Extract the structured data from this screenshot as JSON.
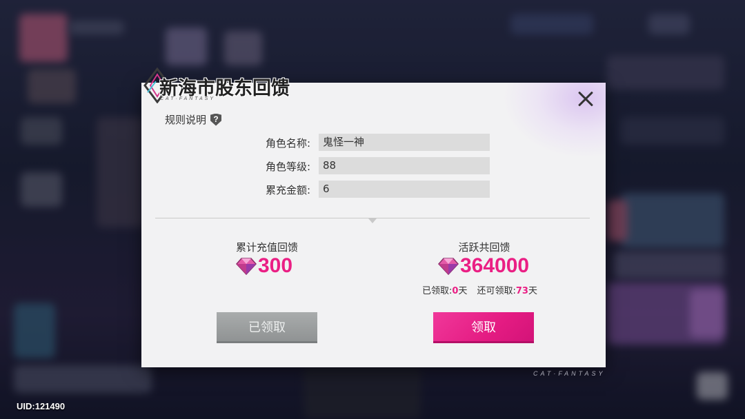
{
  "dialog": {
    "title": "新海市股东回馈",
    "brand_sub": "CAT·FANTASY",
    "rules_label": "规则说明",
    "fields": [
      {
        "label": "角色名称:",
        "value": "鬼怪一神"
      },
      {
        "label": "角色等级:",
        "value": "88"
      },
      {
        "label": "累充金额:",
        "value": "6"
      }
    ],
    "cumulative": {
      "title": "累计充值回馈",
      "amount": "300",
      "button_label": "已领取"
    },
    "activity": {
      "title": "活跃共回馈",
      "amount": "364000",
      "claimed_label": "已领取:",
      "claimed_days": "0",
      "claimed_unit": "天",
      "remaining_label": "还可领取:",
      "remaining_days": "73",
      "remaining_unit": "天",
      "button_label": "领取"
    }
  },
  "footer": {
    "uid": "UID:121490",
    "brand": "CAT·FANTASY"
  },
  "colors": {
    "accent": "#ea1f84",
    "claimed_button": "#9a9d9e",
    "dialog_bg": "#f2f2f3"
  },
  "icons": [
    "help-icon",
    "close-icon",
    "gem-icon",
    "logo-icon"
  ]
}
